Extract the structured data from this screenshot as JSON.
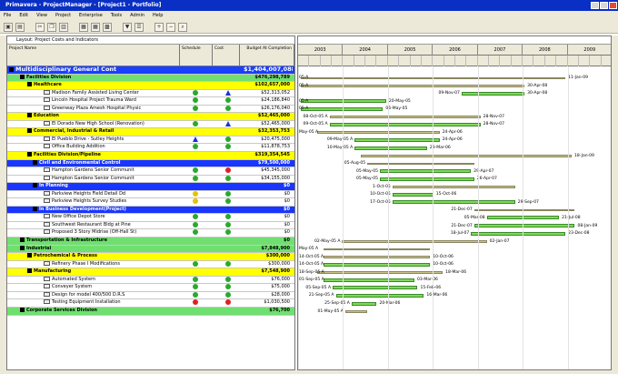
{
  "window": {
    "title": "Primavera - ProjectManager - [Project1 - Portfolio]"
  },
  "menu": [
    "File",
    "Edit",
    "View",
    "Project",
    "Enterprise",
    "Tools",
    "Admin",
    "Help"
  ],
  "panel": {
    "label": "Layout: Project Costs and Indicators"
  },
  "columns": {
    "name": "Project Name",
    "schedule": "Schedule",
    "cost": "Cost",
    "budget": "Budget At Completion"
  },
  "timeline": {
    "years": [
      "2003",
      "2004",
      "2005",
      "2006",
      "2007",
      "2008",
      "2009"
    ]
  },
  "rows": [
    {
      "type": "root",
      "name": "Multidisciplinary General Cont",
      "budget": "$1,404,007,088",
      "bar": null
    },
    {
      "type": "div",
      "name": "Facilities Division",
      "budget": "$476,298,789",
      "bar": {
        "s": 0.01,
        "e": 0.85,
        "ls": "05-A",
        "le": "11-Jan-09",
        "kind": "summary"
      }
    },
    {
      "type": "sub",
      "name": "Healthcare",
      "budget": "$102,657,000",
      "bar": {
        "s": 0.01,
        "e": 0.72,
        "ls": "05-A",
        "le": "30-Apr-08",
        "kind": "summary"
      }
    },
    {
      "type": "item",
      "name": "Madison Family Assisted Living Center",
      "sch": "g",
      "cst": "b",
      "budget": "$52,313,052",
      "bar": {
        "s": 0.52,
        "e": 0.72,
        "ls": "",
        "le": "30-Apr-08",
        "kind": "task",
        "pre": "09-Nov-07"
      }
    },
    {
      "type": "item",
      "name": "Lincoln Hospital Project Trauma Ward",
      "sch": "g",
      "cst": "g",
      "budget": "$24,186,840",
      "bar": {
        "s": 0.01,
        "e": 0.28,
        "ls": "05-A",
        "le": "20-May-05",
        "kind": "task"
      }
    },
    {
      "type": "item",
      "name": "Greenway Plaza Amesh Hospital Physic",
      "sch": "g",
      "cst": "g",
      "budget": "$26,176,040",
      "bar": {
        "s": 0.01,
        "e": 0.27,
        "ls": "05-A",
        "le": "06-May-05",
        "kind": "task"
      }
    },
    {
      "type": "sub",
      "name": "Education",
      "budget": "$52,465,000",
      "bar": {
        "s": 0.1,
        "e": 0.58,
        "ls": "08-Oct-05 A",
        "le": "28-Nov-07",
        "kind": "summary"
      }
    },
    {
      "type": "item",
      "name": "El Dorado New High School (Renovation)",
      "sch": "g",
      "cst": "b",
      "budget": "$52,465,000",
      "bar": {
        "s": 0.1,
        "e": 0.58,
        "ls": "09-Oct-05 A",
        "le": "28-Nov-07",
        "kind": "task"
      }
    },
    {
      "type": "sub",
      "name": "Commercial, Industrial & Retail",
      "budget": "$32,353,753",
      "bar": {
        "s": 0.06,
        "e": 0.45,
        "ls": "May-05 A",
        "le": "24-Apr-06",
        "kind": "summary"
      }
    },
    {
      "type": "item",
      "name": "El Pueblo Drive - Sutley Heights",
      "sch": "b",
      "cst": "g",
      "budget": "$20,475,000",
      "bar": {
        "s": 0.18,
        "e": 0.45,
        "ls": "09-May-05 A",
        "le": "24-Apr-06",
        "kind": "task"
      }
    },
    {
      "type": "item",
      "name": "Office Building Addition",
      "sch": "g",
      "cst": "g",
      "budget": "$11,878,753",
      "bar": {
        "s": 0.18,
        "e": 0.41,
        "ls": "10-May-05 A",
        "le": "23-Mar-06",
        "kind": "task"
      }
    },
    {
      "type": "sub",
      "name": "Facilities Division/Pipeline",
      "budget": "$319,354,545",
      "bar": {
        "s": 0.2,
        "e": 0.87,
        "ls": "",
        "le": "18-Jan-09",
        "kind": "summary"
      }
    },
    {
      "type": "blue",
      "name": "Civil and Environmental Control",
      "budget": "$79,500,000",
      "bar": {
        "s": 0.22,
        "e": 0.56,
        "ls": "05-Aug-05",
        "le": "",
        "kind": "summary"
      }
    },
    {
      "type": "item",
      "name": "Hampton Gardens Senior Communit",
      "sch": "g",
      "cst": "r",
      "budget": "$45,345,000",
      "bar": {
        "s": 0.26,
        "e": 0.55,
        "ls": "05-May-05",
        "le": "29-Apr-07",
        "kind": "task"
      }
    },
    {
      "type": "item",
      "name": "Hampton Gardens Senior Communit",
      "sch": "g",
      "cst": "g",
      "budget": "$34,155,000",
      "bar": {
        "s": 0.26,
        "e": 0.56,
        "ls": "05-May-05",
        "le": "26-Apr-07",
        "kind": "task"
      }
    },
    {
      "type": "blue",
      "name": "In Planning",
      "budget": "$0",
      "bar": {
        "s": 0.3,
        "e": 0.69,
        "ls": "1-Oct-05",
        "le": "",
        "kind": "summary"
      }
    },
    {
      "type": "item",
      "name": "Parkview Heights Field Detail Dd",
      "sch": "y",
      "cst": "g",
      "budget": "$0",
      "bar": {
        "s": 0.3,
        "e": 0.43,
        "ls": "10-Oct-05",
        "le": "15-Oct-06",
        "kind": "task"
      }
    },
    {
      "type": "item",
      "name": "Parkview Heights Survey Studies",
      "sch": "y",
      "cst": "g",
      "budget": "$0",
      "bar": {
        "s": 0.3,
        "e": 0.69,
        "ls": "17-Oct-05",
        "le": "29-Sep-07",
        "kind": "task"
      }
    },
    {
      "type": "blue",
      "name": "In Business Development(Project)",
      "budget": "$0",
      "bar": {
        "s": 0.56,
        "e": 0.88,
        "ls": "21-Dec-07",
        "le": "",
        "kind": "summary"
      }
    },
    {
      "type": "item",
      "name": "New Office Depot Store",
      "sch": "g",
      "cst": "g",
      "budget": "$0",
      "bar": {
        "s": 0.6,
        "e": 0.83,
        "ls": "05-Mar-08",
        "le": "21-Jul-08",
        "kind": "task"
      }
    },
    {
      "type": "item",
      "name": "Southwest Restaurant Bldg at Pine",
      "sch": "g",
      "cst": "g",
      "budget": "$0",
      "bar": {
        "s": 0.56,
        "e": 0.88,
        "ls": "21-Dec-07",
        "le": "08-Jan-09",
        "kind": "task"
      }
    },
    {
      "type": "item",
      "name": "Proposed 3 Story Midrise (Off-Hall St)",
      "sch": "g",
      "cst": "g",
      "budget": "$0",
      "bar": {
        "s": 0.55,
        "e": 0.85,
        "ls": "18-Jul-07",
        "le": "23-Dec-08",
        "kind": "task"
      }
    },
    {
      "type": "div",
      "name": "Transportation & Infrastructure",
      "budget": "$0",
      "bar": {
        "s": 0.14,
        "e": 0.6,
        "ls": "02-May-05 A",
        "le": "02-Jan-07",
        "kind": "summary"
      }
    },
    {
      "type": "div",
      "name": "Industrial",
      "budget": "$7,848,900",
      "bar": {
        "s": 0.08,
        "e": 0.42,
        "ls": "May-05 A",
        "le": "",
        "kind": "summary"
      }
    },
    {
      "type": "sub",
      "name": "Petrochemical & Process",
      "budget": "$300,000",
      "bar": {
        "s": 0.08,
        "e": 0.42,
        "ls": "14-Oct-05 A",
        "le": "10-Oct-06",
        "kind": "summary"
      }
    },
    {
      "type": "item",
      "name": "Refinery Phase I Modifications",
      "sch": "g",
      "cst": "g",
      "budget": "$300,000",
      "bar": {
        "s": 0.08,
        "e": 0.42,
        "ls": "14-Oct-05 A",
        "le": "10-Oct-06",
        "kind": "task"
      }
    },
    {
      "type": "sub",
      "name": "Manufacturing",
      "budget": "$7,548,900",
      "bar": {
        "s": 0.06,
        "e": 0.46,
        "ls": "18-Sep-05 A",
        "le": "18-Mar-06",
        "kind": "summary"
      }
    },
    {
      "type": "item",
      "name": "Automated System",
      "sch": "g",
      "cst": "g",
      "budget": "$76,000",
      "bar": {
        "s": 0.08,
        "e": 0.37,
        "ls": "01-Sep-05 A",
        "le": "03-Mar-06",
        "kind": "task"
      }
    },
    {
      "type": "item",
      "name": "Conveyer System",
      "sch": "g",
      "cst": "g",
      "budget": "$75,000",
      "bar": {
        "s": 0.11,
        "e": 0.38,
        "ls": "05-Sep-05 A",
        "le": "15-Feb-06",
        "kind": "task"
      }
    },
    {
      "type": "item",
      "name": "Design for model 400/500 D.R.S",
      "sch": "g",
      "cst": "g",
      "budget": "$28,000",
      "bar": {
        "s": 0.12,
        "e": 0.4,
        "ls": "21-Sep-05 A",
        "le": "16-Mar-06",
        "kind": "task"
      }
    },
    {
      "type": "item",
      "name": "Testing Equipment Installation",
      "sch": "r",
      "cst": "r",
      "budget": "$1,030,500",
      "bar": {
        "s": 0.17,
        "e": 0.25,
        "ls": "25-Sep-05 A",
        "le": "20-Mar-06",
        "kind": "task"
      }
    },
    {
      "type": "div",
      "name": "Corporate Services Division",
      "budget": "$76,700",
      "bar": {
        "s": 0.15,
        "e": 0.22,
        "ls": "01-May-05 A",
        "le": "",
        "kind": "summary"
      }
    }
  ]
}
